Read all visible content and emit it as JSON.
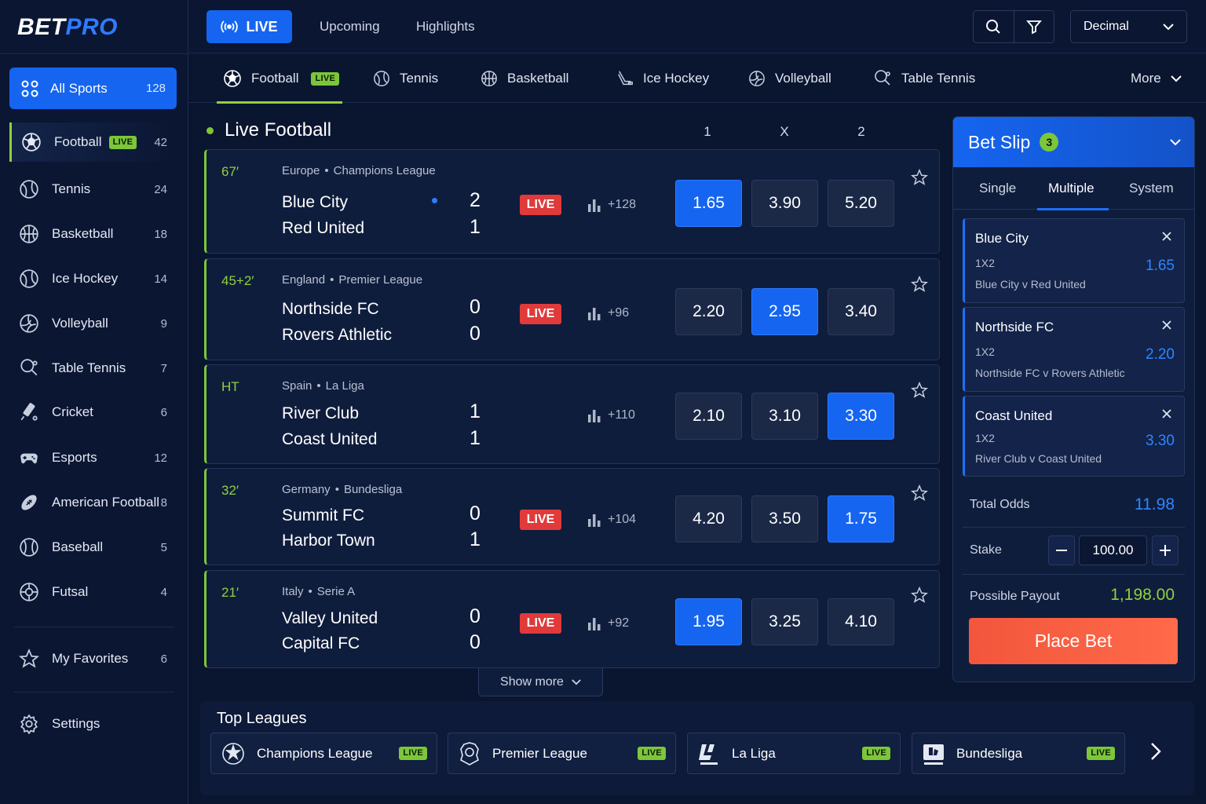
{
  "brand": {
    "part1": "BET",
    "part2": "PRO"
  },
  "topnav": {
    "live_label": "LIVE",
    "tabs": [
      "Upcoming",
      "Highlights"
    ],
    "odds_format": "Decimal"
  },
  "sidebar": {
    "all_sports": {
      "label": "All Sports",
      "count": "128"
    },
    "items": [
      {
        "label": "Football",
        "count": "42",
        "live": "LIVE",
        "icon": "football-icon"
      },
      {
        "label": "Tennis",
        "count": "24",
        "icon": "tennis-icon"
      },
      {
        "label": "Basketball",
        "count": "18",
        "icon": "basketball-icon"
      },
      {
        "label": "Ice Hockey",
        "count": "14",
        "icon": "tennis-icon"
      },
      {
        "label": "Volleyball",
        "count": "9",
        "icon": "volleyball-icon"
      },
      {
        "label": "Table Tennis",
        "count": "7",
        "icon": "table-tennis-icon"
      },
      {
        "label": "Cricket",
        "count": "6",
        "icon": "cricket-icon"
      },
      {
        "label": "Esports",
        "count": "12",
        "icon": "gamepad-icon"
      },
      {
        "label": "American Football",
        "count": "8",
        "icon": "american-football-icon"
      },
      {
        "label": "Baseball",
        "count": "5",
        "icon": "baseball-icon"
      },
      {
        "label": "Futsal",
        "count": "4",
        "icon": "futsal-icon"
      }
    ],
    "favorites": {
      "label": "My Favorites",
      "count": "6"
    },
    "settings": {
      "label": "Settings"
    }
  },
  "sport_tabs": {
    "items": [
      {
        "label": "Football",
        "live": "LIVE"
      },
      {
        "label": "Tennis"
      },
      {
        "label": "Basketball"
      },
      {
        "label": "Ice Hockey"
      },
      {
        "label": "Volleyball"
      },
      {
        "label": "Table Tennis"
      }
    ],
    "more": "More"
  },
  "live_section": {
    "title": "Live Football",
    "columns": [
      "1",
      "X",
      "2"
    ],
    "live_tag": "LIVE",
    "matches": [
      {
        "time": "67′",
        "country": "Europe",
        "league": "Champions League",
        "home": "Blue City",
        "away": "Red United",
        "home_score": "2",
        "away_score": "1",
        "live": true,
        "markets": "+128",
        "odds": [
          "1.65",
          "3.90",
          "5.20"
        ],
        "selected": 0
      },
      {
        "time": "45+2′",
        "country": "England",
        "league": "Premier League",
        "home": "Northside FC",
        "away": "Rovers Athletic",
        "home_score": "0",
        "away_score": "0",
        "live": true,
        "markets": "+96",
        "odds": [
          "2.20",
          "2.95",
          "3.40"
        ],
        "selected": 1
      },
      {
        "time": "HT",
        "country": "Spain",
        "league": "La Liga",
        "home": "River Club",
        "away": "Coast United",
        "home_score": "1",
        "away_score": "1",
        "live": false,
        "markets": "+110",
        "odds": [
          "2.10",
          "3.10",
          "3.30"
        ],
        "selected": 2
      },
      {
        "time": "32′",
        "country": "Germany",
        "league": "Bundesliga",
        "home": "Summit FC",
        "away": "Harbor Town",
        "home_score": "0",
        "away_score": "1",
        "live": true,
        "markets": "+104",
        "odds": [
          "4.20",
          "3.50",
          "1.75"
        ],
        "selected": 2
      },
      {
        "time": "21′",
        "country": "Italy",
        "league": "Serie A",
        "home": "Valley United",
        "away": "Capital FC",
        "home_score": "0",
        "away_score": "0",
        "live": true,
        "markets": "+92",
        "odds": [
          "1.95",
          "3.25",
          "4.10"
        ],
        "selected": 0
      }
    ],
    "show_more": "Show more"
  },
  "top_leagues": {
    "title": "Top Leagues",
    "items": [
      {
        "label": "Champions League",
        "live": "LIVE"
      },
      {
        "label": "Premier League",
        "live": "LIVE"
      },
      {
        "label": "La Liga",
        "live": "LIVE"
      },
      {
        "label": "Bundesliga",
        "live": "LIVE"
      }
    ]
  },
  "betslip": {
    "title": "Bet Slip",
    "count": "3",
    "tabs": [
      "Single",
      "Multiple",
      "System"
    ],
    "active_tab": "Multiple",
    "selections": [
      {
        "team": "Blue City",
        "market": "1X2",
        "event": "Blue City v Red United",
        "odds": "1.65"
      },
      {
        "team": "Northside FC",
        "market": "1X2",
        "event": "Northside FC v Rovers Athletic",
        "odds": "2.20"
      },
      {
        "team": "Coast United",
        "market": "1X2",
        "event": "River Club v Coast United",
        "odds": "3.30"
      }
    ],
    "total_odds_label": "Total Odds",
    "total_odds": "11.98",
    "stake_label": "Stake",
    "stake": "100.00",
    "payout_label": "Possible Payout",
    "payout": "1,198.00",
    "place_bet": "Place Bet"
  },
  "colors": {
    "accent": "#1565f0",
    "live_green": "#7cc63a",
    "live_red": "#e03a3a",
    "cta": "#f2563c",
    "bg": "#0a1530"
  }
}
